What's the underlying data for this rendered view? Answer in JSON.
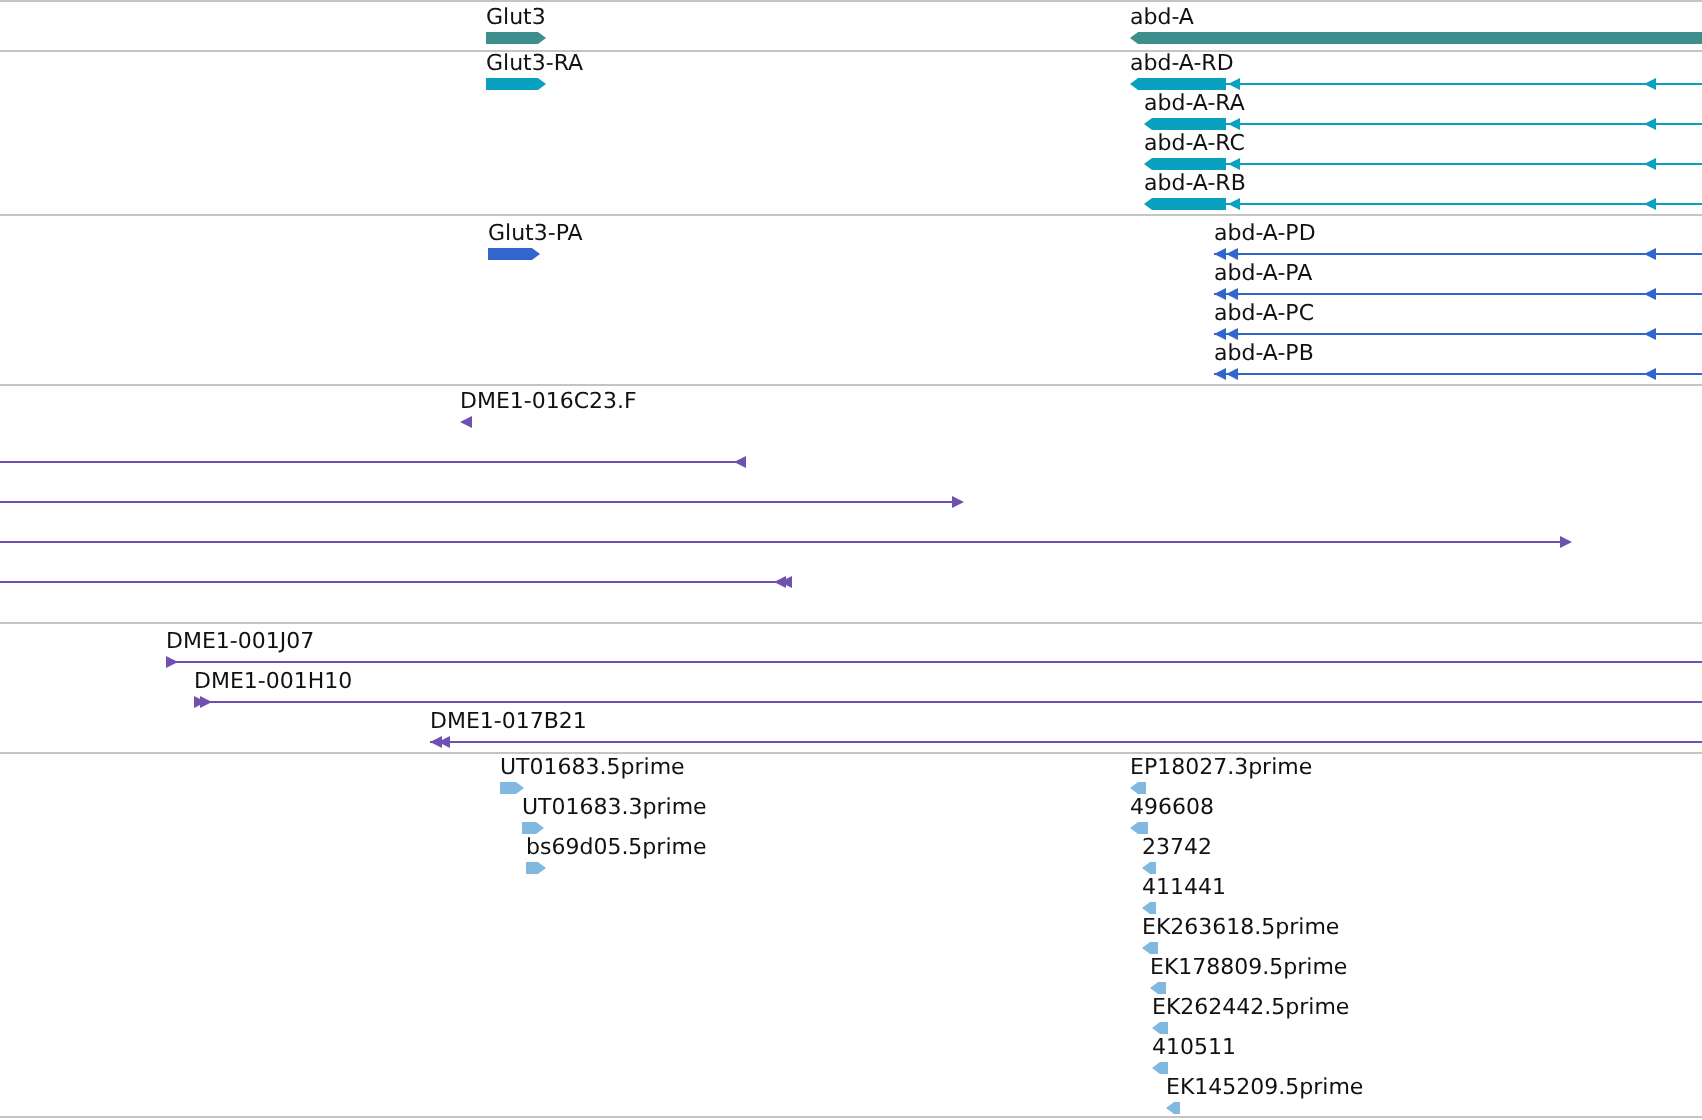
{
  "tracks": [
    {
      "color": "#3f8e8e",
      "features": [
        {
          "label": "Glut3",
          "kind": "block",
          "reverse": false
        },
        {
          "label": "abd-A",
          "kind": "block",
          "reverse": true
        }
      ]
    },
    {
      "color": "#0aa0c0",
      "features": [
        {
          "label": "Glut3-RA",
          "kind": "block",
          "reverse": false
        },
        {
          "label": "abd-A-RD",
          "kind": "transcript",
          "reverse": true
        },
        {
          "label": "abd-A-RA",
          "kind": "transcript",
          "reverse": true
        },
        {
          "label": "abd-A-RC",
          "kind": "transcript",
          "reverse": true
        },
        {
          "label": "abd-A-RB",
          "kind": "transcript",
          "reverse": true
        }
      ]
    },
    {
      "color": "#3366cc",
      "features": [
        {
          "label": "Glut3-PA",
          "kind": "block",
          "reverse": false
        },
        {
          "label": "abd-A-PD",
          "kind": "line",
          "reverse": true
        },
        {
          "label": "abd-A-PA",
          "kind": "line",
          "reverse": true
        },
        {
          "label": "abd-A-PC",
          "kind": "line",
          "reverse": true
        },
        {
          "label": "abd-A-PB",
          "kind": "line",
          "reverse": true
        }
      ]
    },
    {
      "color": "#7050b0",
      "features": [
        {
          "label": "DME1-016C23.F",
          "kind": "line",
          "reverse": true
        },
        {
          "kind": "line",
          "reverse": true
        },
        {
          "kind": "line",
          "reverse": false
        },
        {
          "kind": "line",
          "reverse": false
        },
        {
          "kind": "line",
          "reverse": true
        }
      ]
    },
    {
      "color": "#7050b0",
      "features": [
        {
          "label": "DME1-001J07",
          "kind": "line",
          "reverse": false
        },
        {
          "label": "DME1-001H10",
          "kind": "line",
          "reverse": false
        },
        {
          "label": "DME1-017B21",
          "kind": "line",
          "reverse": true
        }
      ]
    },
    {
      "color": "#80b8e0",
      "features": [
        {
          "label": "UT01683.5prime",
          "kind": "block",
          "reverse": false
        },
        {
          "label": "UT01683.3prime",
          "kind": "block",
          "reverse": false
        },
        {
          "label": "bs69d05.5prime",
          "kind": "block",
          "reverse": false
        },
        {
          "label": "EP18027.3prime",
          "kind": "block",
          "reverse": true
        },
        {
          "label": "496608",
          "kind": "block",
          "reverse": true
        },
        {
          "label": "23742",
          "kind": "block",
          "reverse": true
        },
        {
          "label": "411441",
          "kind": "block",
          "reverse": true
        },
        {
          "label": "EK263618.5prime",
          "kind": "block",
          "reverse": true
        },
        {
          "label": "EK178809.5prime",
          "kind": "block",
          "reverse": true
        },
        {
          "label": "EK262442.5prime",
          "kind": "block",
          "reverse": true
        },
        {
          "label": "410511",
          "kind": "block",
          "reverse": true
        },
        {
          "label": "EK145209.5prime",
          "kind": "block",
          "reverse": true
        }
      ]
    }
  ]
}
